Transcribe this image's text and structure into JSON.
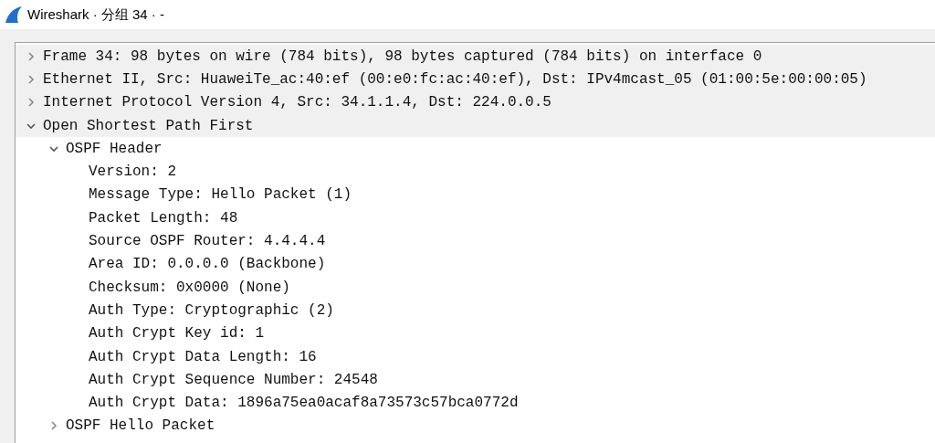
{
  "window": {
    "title": "Wireshark · 分组 34 · -"
  },
  "tree": [
    {
      "label": "Frame 34: 98 bytes on wire (784 bits), 98 bytes captured (784 bits) on interface 0",
      "expanded": false
    },
    {
      "label": "Ethernet II, Src: HuaweiTe_ac:40:ef (00:e0:fc:ac:40:ef), Dst: IPv4mcast_05 (01:00:5e:00:00:05)",
      "expanded": false
    },
    {
      "label": "Internet Protocol Version 4, Src: 34.1.1.4, Dst: 224.0.0.5",
      "expanded": false
    },
    {
      "label": "Open Shortest Path First",
      "expanded": true,
      "children": [
        {
          "label": "OSPF Header",
          "expanded": true,
          "children": [
            {
              "label": "Version: 2"
            },
            {
              "label": "Message Type: Hello Packet (1)"
            },
            {
              "label": "Packet Length: 48"
            },
            {
              "label": "Source OSPF Router: 4.4.4.4"
            },
            {
              "label": "Area ID: 0.0.0.0 (Backbone)"
            },
            {
              "label": "Checksum: 0x0000 (None)"
            },
            {
              "label": "Auth Type: Cryptographic (2)"
            },
            {
              "label": "Auth Crypt Key id: 1"
            },
            {
              "label": "Auth Crypt Data Length: 16"
            },
            {
              "label": "Auth Crypt Sequence Number: 24548"
            },
            {
              "label": "Auth Crypt Data: 1896a75ea0acaf8a73573c57bca0772d"
            }
          ]
        },
        {
          "label": "OSPF Hello Packet",
          "expanded": false
        }
      ]
    }
  ]
}
